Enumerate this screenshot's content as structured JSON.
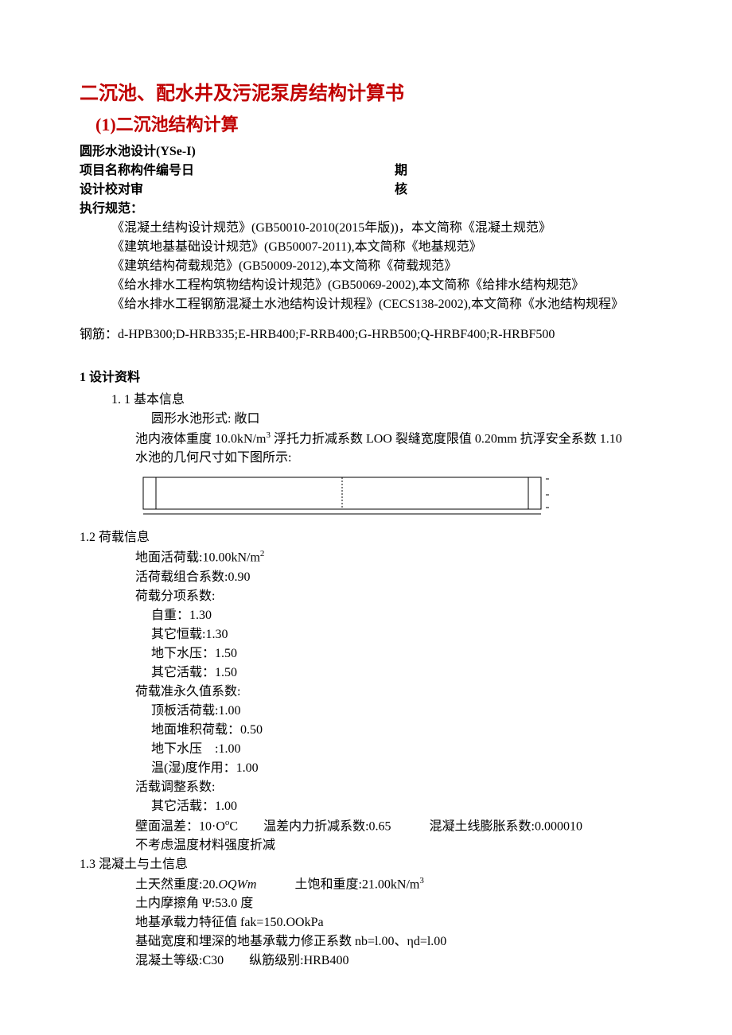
{
  "title_main": "二沉池、配水井及污泥泵房结构计算书",
  "title_sub": "(1)二沉池结构计算",
  "design_line": "圆形水池设计(YSe-I)",
  "proj_left": "项目名称构件编号日",
  "proj_right": "期",
  "check_left": "设计校对审",
  "check_right": "核",
  "spec_heading": "执行规范：",
  "specs": [
    "《混凝土结构设计规范》(GB50010-2010(2015年版))，本文简称《混凝土规范》",
    "《建筑地基基础设计规范》(GB50007-2011),本文简称《地基规范》",
    "《建筑结构荷载规范》(GB50009-2012),本文简称《荷载规范》",
    "《给水排水工程构筑物结构设计规范》(GB50069-2002),本文简称《给排水结构规范》",
    "《给水排水工程钢筋混凝土水池结构设计规程》(CECS138-2002),本文简称《水池结构规程》"
  ],
  "rebar_label": "钢筋：d-HPB300;D-HRB335;E-HRB400;F-RRB400;G-HRB500;Q-HRBF400;R-HRBF500",
  "sect1": "1 设计资料",
  "sect11": "1. 1 基本信息",
  "shape": "圆形水池形式: 敞口",
  "liquid_line_a": "池内液体重度 10.0kN/m",
  "liquid_line_b": " 浮托力折减系数 LOO 裂缝宽度限值 0.20mm 抗浮安全系数 1.10",
  "geom_line": "水池的几何尺寸如下图所示:",
  "sect12": "1.2 荷载信息",
  "live_surface": "地面活荷载:10.00kN/m",
  "live_comb": "活荷载组合系数:0.90",
  "partial_heading": "荷载分项系数:",
  "partial_1": "自重：1.30",
  "partial_2": "其它恒载:1.30",
  "partial_3": "地下水压：1.50",
  "partial_4": "其它活载：1.50",
  "quasi_heading": "荷载准永久值系数:",
  "quasi_1": "顶板活荷载:1.00",
  "quasi_2": "地面堆积荷载：0.50",
  "quasi_3": "地下水压　:1.00",
  "quasi_4": "温(湿)度作用：1.00",
  "adj_heading": "活载调整系数:",
  "adj_1": "其它活载：1.00",
  "wall_temp_a": "壁面温差：10·O",
  "wall_temp_unit": "o",
  "wall_temp_c": "C　　温差内力折减系数:0.65　　　混凝土线膨胀系数:0.000010",
  "temp_note": "不考虑温度材料强度折减",
  "sect13": "1.3 混凝土与土信息",
  "soil_nat_a": "土天然重度:20.",
  "soil_nat_i": "OQWm",
  "soil_sat": "　　　土饱和重度:21.00kN/m",
  "friction": "土内摩擦角 Ψ:53.0 度",
  "bearing": "地基承载力特征值 fak=150.OOkPa",
  "corr": "基础宽度和埋深的地基承载力修正系数 nb=l.00、ηd=l.00",
  "concrete": "混凝土等级:C30　　纵筋级别:HRB400"
}
